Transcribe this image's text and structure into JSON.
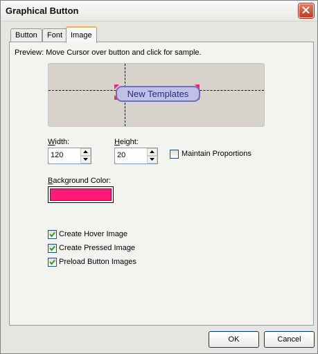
{
  "window": {
    "title": "Graphical Button"
  },
  "tabs": [
    {
      "label": "Button"
    },
    {
      "label": "Font"
    },
    {
      "label": "Image"
    }
  ],
  "preview": {
    "label": "Preview: Move Cursor over button and click for sample.",
    "button_text": "New Templates",
    "button_fill": "#bfc0e6",
    "corner_color": "#ff1a8c"
  },
  "width": {
    "label_prefix": "W",
    "label_rest": "idth:",
    "value": "120"
  },
  "height": {
    "label_prefix": "H",
    "label_rest": "eight:",
    "value": "20"
  },
  "maintain_proportions": {
    "label": "Maintain Proportions",
    "checked": false
  },
  "background_color": {
    "label_prefix": "B",
    "label_rest": "ackground Color:",
    "value": "#ff1a7a"
  },
  "options": [
    {
      "label": "Create Hover Image",
      "checked": true
    },
    {
      "label": "Create Pressed Image",
      "checked": true
    },
    {
      "label": "Preload Button Images",
      "checked": true
    }
  ],
  "footer": {
    "ok_label": "OK",
    "cancel_label": "Cancel"
  }
}
